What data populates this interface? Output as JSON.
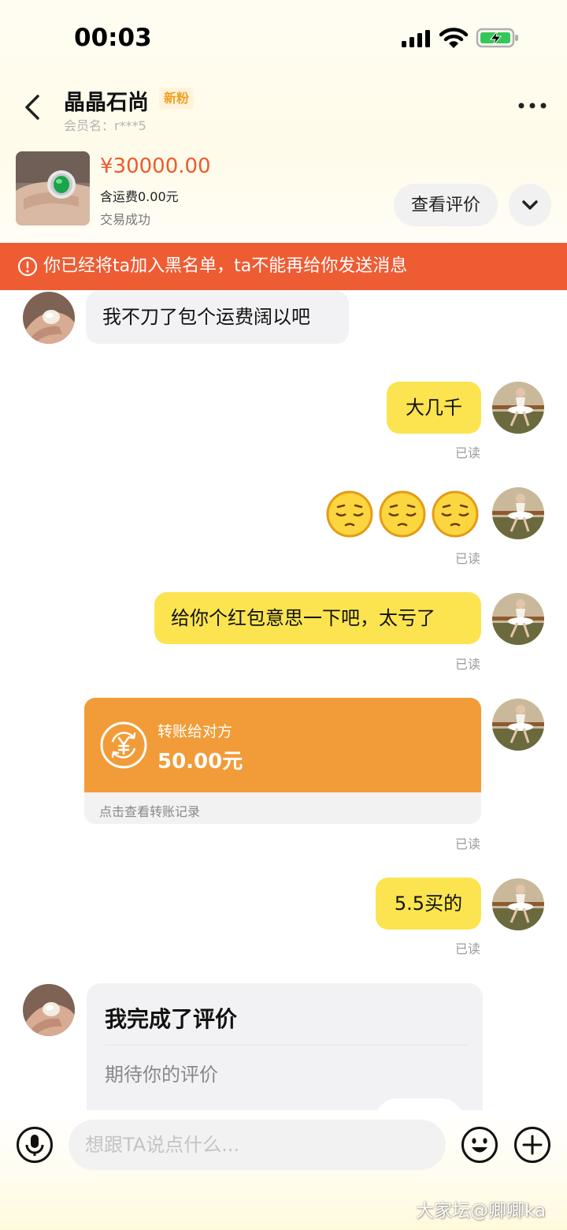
{
  "status_bar": {
    "time": "00:03"
  },
  "header": {
    "name": "晶晶石尚",
    "tag": "新粉",
    "member": "会员名：r***5"
  },
  "product": {
    "price": "¥30000.00",
    "shipping": "含运费0.00元",
    "status": "交易成功",
    "review_button": "查看评价"
  },
  "banner": {
    "text": "你已经将ta加入黑名单，ta不能再给你发送消息"
  },
  "messages": {
    "m1": {
      "text": "我不刀了包个运费阔以吧"
    },
    "m2": {
      "text": "大几千",
      "read": "已读"
    },
    "m3": {
      "emojis": [
        "pensive-face",
        "pensive-face",
        "pensive-face"
      ],
      "read": "已读"
    },
    "m4": {
      "text": "给你个红包意思一下吧，太亏了",
      "read": "已读"
    },
    "m5": {
      "title": "转账给对方",
      "amount": "50.00元",
      "footer": "点击查看转账记录",
      "read": "已读"
    },
    "m6": {
      "text": "5.5买的",
      "read": "已读"
    },
    "m7": {
      "title": "我完成了评价",
      "subtitle": "期待你的评价"
    }
  },
  "input": {
    "placeholder": "想跟TA说点什么..."
  },
  "watermark": "大家坛@卿卿ka",
  "colors": {
    "accent": "#ee5a2b",
    "banner": "#ee5c34",
    "bubble_self": "#fbe450",
    "bubble_other": "#f2f2f4",
    "transfer": "#f19c38",
    "tag_text": "#f2a021"
  }
}
